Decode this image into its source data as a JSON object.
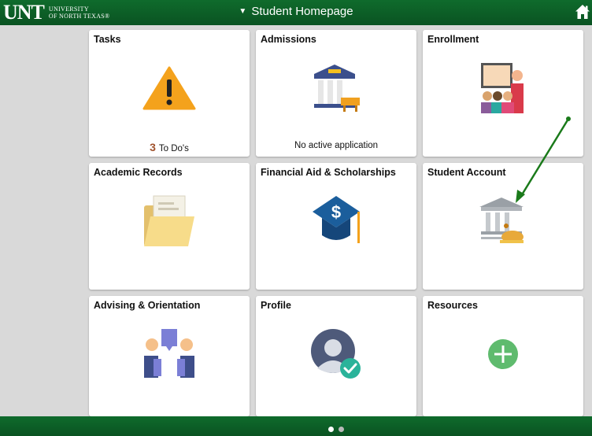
{
  "header": {
    "logo_mark": "UNT",
    "logo_line1": "UNIVERSITY",
    "logo_line2": "OF NORTH TEXAS®",
    "page_title": "Student Homepage",
    "caret": "▼"
  },
  "tiles": [
    {
      "title": "Tasks",
      "count": "3",
      "footer": "To Do's",
      "icon": "warning-icon"
    },
    {
      "title": "Admissions",
      "footer": "No active application",
      "icon": "university-building-icon"
    },
    {
      "title": "Enrollment",
      "icon": "classroom-icon"
    },
    {
      "title": "Academic Records",
      "icon": "folder-icon"
    },
    {
      "title": "Financial Aid & Scholarships",
      "icon": "graduation-cap-dollar-icon"
    },
    {
      "title": "Student Account",
      "icon": "bank-money-icon"
    },
    {
      "title": "Advising & Orientation",
      "icon": "advisors-icon"
    },
    {
      "title": "Profile",
      "icon": "profile-check-icon"
    },
    {
      "title": "Resources",
      "icon": "add-plus-icon"
    }
  ],
  "pagination": {
    "pages": 2,
    "current": 1
  },
  "colors": {
    "header_bg": "#0a5322",
    "accent_arrow": "#1a7a1a",
    "warning": "#f4a21c",
    "plus": "#5fbb6e"
  }
}
